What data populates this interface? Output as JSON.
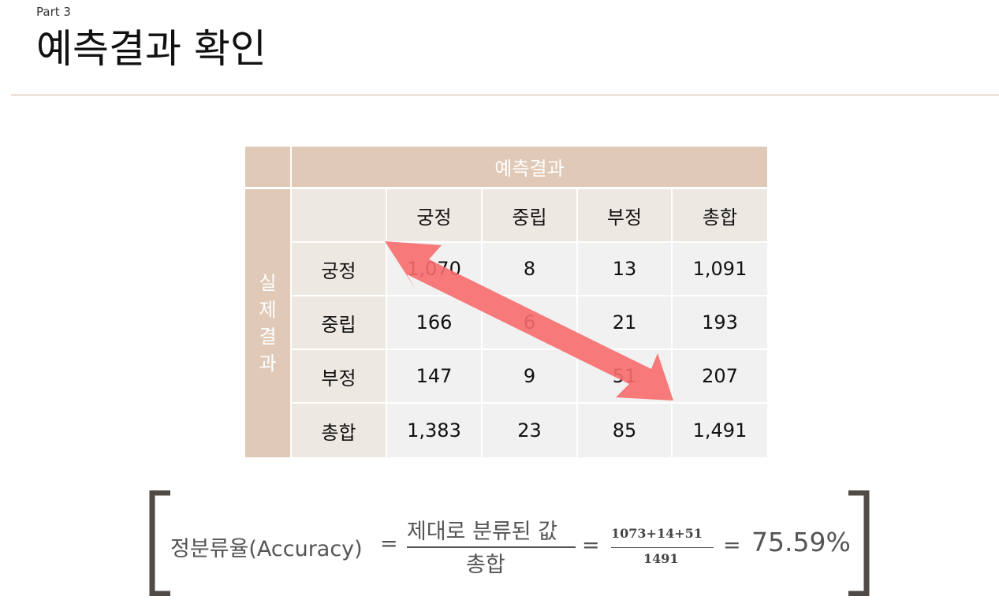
{
  "header": {
    "part_label": "Part 3",
    "title": "예측결과 확인"
  },
  "table": {
    "predicted_header": "예측결과",
    "actual_header_chars": [
      "실",
      "제",
      "결",
      "과"
    ],
    "columns": [
      "궁정",
      "중립",
      "부정",
      "총합"
    ],
    "rows": [
      {
        "label": "궁정",
        "values": [
          "1,070",
          "8",
          "13",
          "1,091"
        ]
      },
      {
        "label": "중립",
        "values": [
          "166",
          "6",
          "21",
          "193"
        ]
      },
      {
        "label": "부정",
        "values": [
          "147",
          "9",
          "51",
          "207"
        ]
      },
      {
        "label": "총합",
        "values": [
          "1,383",
          "23",
          "85",
          "1,491"
        ]
      }
    ],
    "arrow_color": "#f76b6b"
  },
  "formula": {
    "lhs": "정분류율(Accuracy)",
    "eq1": "=",
    "numerator": "제대로 분류된 값",
    "denominator": "총합",
    "eq2": "=",
    "small_numerator": "1073+14+51",
    "small_denominator": "1491",
    "eq3": "=",
    "result": "75.59%"
  }
}
